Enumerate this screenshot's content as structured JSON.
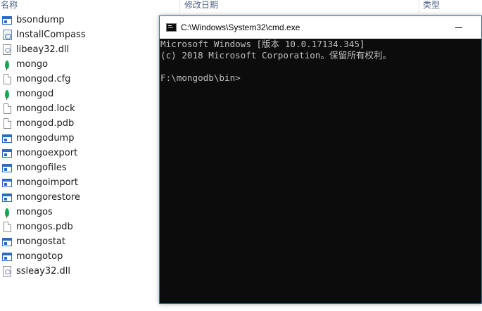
{
  "explorer": {
    "columns": {
      "name": "名称",
      "modified": "修改日期",
      "type": "类型"
    },
    "files": [
      {
        "name": "bsondump",
        "icon": "exe-icon"
      },
      {
        "name": "InstallCompass",
        "icon": "compass-script-icon"
      },
      {
        "name": "libeay32.dll",
        "icon": "dll-icon"
      },
      {
        "name": "mongo",
        "icon": "mongodb-leaf-icon"
      },
      {
        "name": "mongod.cfg",
        "icon": "document-icon"
      },
      {
        "name": "mongod",
        "icon": "mongodb-leaf-icon"
      },
      {
        "name": "mongod.lock",
        "icon": "document-icon"
      },
      {
        "name": "mongod.pdb",
        "icon": "document-icon"
      },
      {
        "name": "mongodump",
        "icon": "exe-icon"
      },
      {
        "name": "mongoexport",
        "icon": "exe-icon"
      },
      {
        "name": "mongofiles",
        "icon": "exe-icon"
      },
      {
        "name": "mongoimport",
        "icon": "exe-icon"
      },
      {
        "name": "mongorestore",
        "icon": "exe-icon"
      },
      {
        "name": "mongos",
        "icon": "mongodb-leaf-icon"
      },
      {
        "name": "mongos.pdb",
        "icon": "document-icon"
      },
      {
        "name": "mongostat",
        "icon": "exe-icon"
      },
      {
        "name": "mongotop",
        "icon": "exe-icon"
      },
      {
        "name": "ssleay32.dll",
        "icon": "dll-icon"
      }
    ]
  },
  "cmd": {
    "title": "C:\\Windows\\System32\\cmd.exe",
    "lines": [
      "Microsoft Windows [版本 10.0.17134.345]",
      "(c) 2018 Microsoft Corporation。保留所有权利。",
      "",
      "F:\\mongodb\\bin>"
    ],
    "colors": {
      "background": "#0c0c0c",
      "text": "#c0c0c0",
      "border": "#3a6ea5"
    }
  }
}
